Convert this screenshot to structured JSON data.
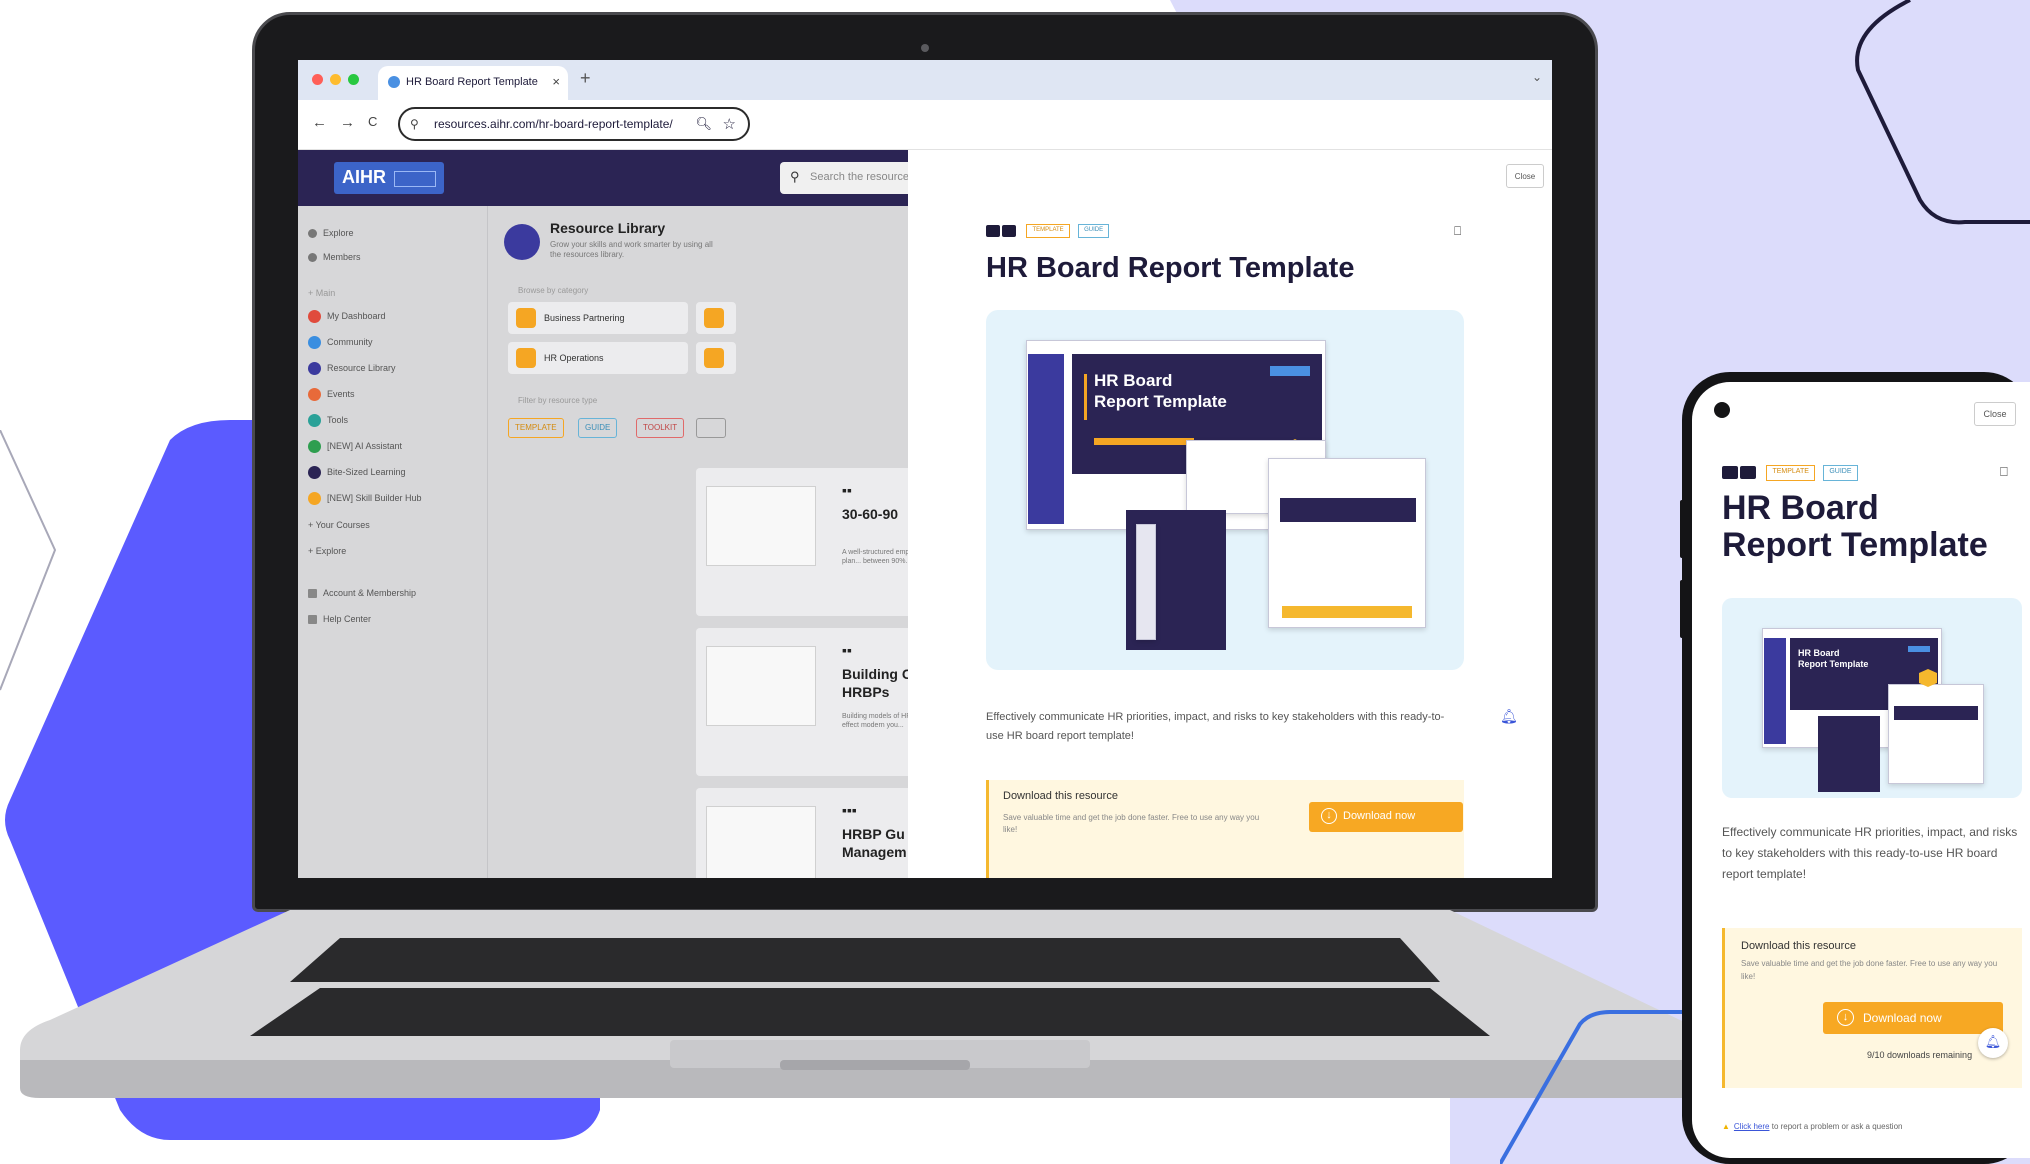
{
  "browser": {
    "tab_title": "HR Board Report Template",
    "tab_close": "×",
    "new_tab": "+",
    "url": "resources.aihr.com/hr-board-report-template/",
    "back": "←",
    "forward": "→",
    "reload": "C"
  },
  "app": {
    "logo": "AIHR",
    "search_placeholder": "Search the resource",
    "sidebar": {
      "top_items": [
        "Explore",
        "Members"
      ],
      "section_label": "Main",
      "items": [
        "My Dashboard",
        "Community",
        "Resource Library",
        "Events",
        "Tools",
        "[NEW] AI Assistant",
        "Bite-Sized Learning",
        "[NEW] Skill Builder Hub"
      ],
      "collapsibles": [
        "Your Courses",
        "Explore"
      ],
      "bottom_items": [
        "Account & Membership",
        "Help Center"
      ]
    },
    "library": {
      "title": "Resource Library",
      "description": "Grow your skills and work smarter by using all the resources library.",
      "category_label": "Browse by category",
      "categories": [
        "Business Partnering",
        "HR Operations"
      ],
      "filter_label": "Filter by resource type",
      "chips": [
        "TEMPLATE",
        "GUIDE",
        "TOOLKIT"
      ]
    },
    "cards": [
      {
        "title": "30-60-90",
        "desc": "A well-structured employee plan... between 90%..."
      },
      {
        "title_line1": "Building C",
        "title_line2": "HRBPs",
        "desc": "Building models of HRBPs to effect modern you..."
      },
      {
        "title_line1": "HRBP Gu",
        "title_line2": "Managem",
        "desc": ""
      }
    ]
  },
  "modal": {
    "close_label": "Close",
    "tags": [
      "TEMPLATE",
      "GUIDE"
    ],
    "title": "HR Board Report Template",
    "preview": {
      "heading_line1": "HR Board",
      "heading_line2": "Report Template"
    },
    "description": "Effectively communicate HR priorities, impact, and risks to key stakeholders with this ready-to-use HR board report template!",
    "download": {
      "title": "Download this resource",
      "description": "Save valuable time and get the job done faster. Free to use any way you like!",
      "button": "Download now"
    }
  },
  "phone": {
    "close_label": "Close",
    "tags": [
      "TEMPLATE",
      "GUIDE"
    ],
    "title_line1": "HR Board",
    "title_line2": "Report Template",
    "preview": {
      "heading_line1": "HR Board",
      "heading_line2": "Report Template"
    },
    "description": "Effectively communicate HR priorities, impact, and risks to key stakeholders with this ready-to-use HR board report template!",
    "download": {
      "title": "Download this resource",
      "description": "Save valuable time and get the job done faster. Free to use any way you like!",
      "button": "Download now",
      "remaining": "9/10 downloads remaining"
    },
    "footer_link": "Click here",
    "footer_text": " to report a problem or ask a question"
  },
  "colors": {
    "lilac": "#dcdcfb",
    "blue_hex": "#5b5bff",
    "navy": "#2b2454",
    "orange": "#f7a823",
    "preview_bg": "#e4f3fb"
  },
  "icons": [
    "search-icon",
    "star-icon",
    "bookmark-icon",
    "download-icon",
    "bell-icon",
    "close-icon"
  ]
}
